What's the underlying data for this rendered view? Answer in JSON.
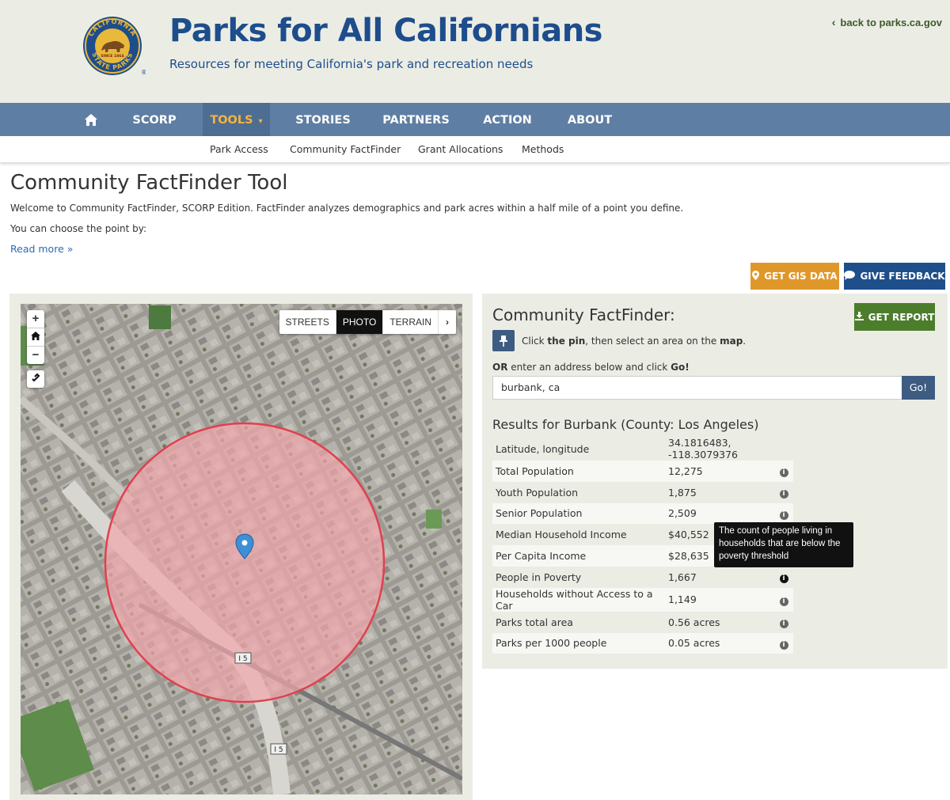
{
  "header": {
    "title": "Parks for All Californians",
    "subtitle": "Resources for meeting California's park and recreation needs",
    "back_link": "back to parks.ca.gov",
    "logo_text_top": "CALIFORNIA",
    "logo_text_bottom": "STATE PARKS",
    "logo_since": "SINCE 1864"
  },
  "nav": {
    "items": [
      "SCORP",
      "TOOLS",
      "STORIES",
      "PARTNERS",
      "ACTION",
      "ABOUT"
    ],
    "active": "TOOLS",
    "tools_caret": "▾",
    "sub_items": [
      "Park Access",
      "Community FactFinder",
      "Grant Allocations",
      "Methods"
    ]
  },
  "intro": {
    "title": "Community FactFinder Tool",
    "text1": "Welcome to Community FactFinder, SCORP Edition. FactFinder analyzes demographics and park acres within a half mile of a point you define.",
    "text2": "You can choose the point by:",
    "read_more": "Read more »"
  },
  "buttons": {
    "gis": "GET GIS DATA",
    "feedback": "GIVE FEEDBACK",
    "report": "GET REPORT"
  },
  "map": {
    "zoom_in": "+",
    "zoom_out": "−",
    "basemaps": [
      "STREETS",
      "PHOTO",
      "TERRAIN"
    ],
    "active_basemap": "PHOTO",
    "highway_labels": [
      "I 5",
      "I 5"
    ]
  },
  "factfinder": {
    "title": "Community FactFinder:",
    "instr_pre": "Click ",
    "instr_pin": "the pin",
    "instr_mid": ", then select an area on the ",
    "instr_map": "map",
    "instr_end": ".",
    "or_label": "OR",
    "or_mid": " enter an address below and click ",
    "or_go": "Go!",
    "address_value": "burbank, ca",
    "go_button": "Go!",
    "results_title": "Results for Burbank (County: Los Angeles)",
    "rows": [
      {
        "label": "Latitude, longitude",
        "value": "34.1816483, -118.3079376",
        "info": false
      },
      {
        "label": "Total Population",
        "value": "12,275",
        "info": true
      },
      {
        "label": "Youth Population",
        "value": "1,875",
        "info": true
      },
      {
        "label": "Senior Population",
        "value": "2,509",
        "info": true
      },
      {
        "label": "Median Household Income",
        "value": "$40,552",
        "info": true
      },
      {
        "label": "Per Capita Income",
        "value": "$28,635",
        "info": true
      },
      {
        "label": "People in Poverty",
        "value": "1,667",
        "info": true
      },
      {
        "label": "Households without Access to a Car",
        "value": "1,149",
        "info": true
      },
      {
        "label": "Parks total area",
        "value": "0.56 acres",
        "info": true
      },
      {
        "label": "Parks per 1000 people",
        "value": "0.05 acres",
        "info": true
      }
    ],
    "tooltip": "The count of people living in households that are below the poverty threshold"
  },
  "colors": {
    "header_bg": "#ebede5",
    "title_blue": "#1e4d8c",
    "nav_bg": "#5f7ea3",
    "nav_active_text": "#f4b441",
    "gis_orange": "#e0972a",
    "feedback_blue": "#1f4f8b",
    "report_green": "#4c7d2c",
    "circle_fill": "#f2a6ac"
  }
}
